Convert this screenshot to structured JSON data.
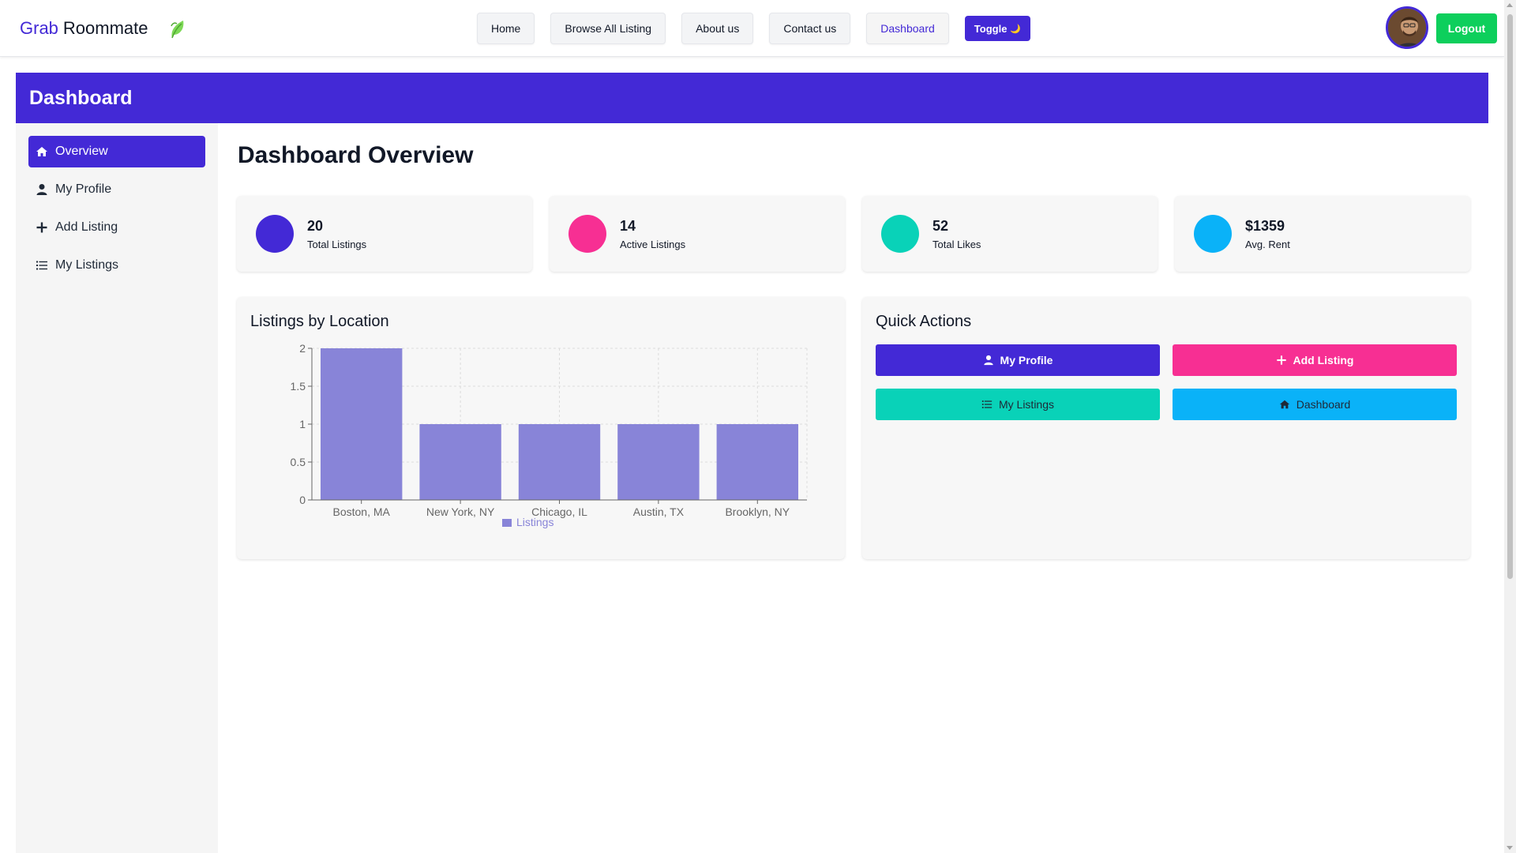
{
  "navbar": {
    "brand_part1": "Grab",
    "brand_part2": "Roommate",
    "links": [
      "Home",
      "Browse All Listing",
      "About us",
      "Contact us",
      "Dashboard"
    ],
    "active_link": "Dashboard",
    "toggle_label": "Toggle",
    "toggle_icon": "🌙",
    "logout_label": "Logout"
  },
  "header": {
    "title": "Dashboard"
  },
  "sidebar": {
    "items": [
      {
        "label": "Overview",
        "icon": "home-icon",
        "active": true
      },
      {
        "label": "My Profile",
        "icon": "user-icon",
        "active": false
      },
      {
        "label": "Add Listing",
        "icon": "plus-icon",
        "active": false
      },
      {
        "label": "My Listings",
        "icon": "list-icon",
        "active": false
      }
    ]
  },
  "main": {
    "title": "Dashboard Overview",
    "stats": [
      {
        "value": "20",
        "label": "Total Listings",
        "color": "#4329d6"
      },
      {
        "value": "14",
        "label": "Active Listings",
        "color": "#f72f93"
      },
      {
        "value": "52",
        "label": "Total Likes",
        "color": "#09d2b8"
      },
      {
        "value": "$1359",
        "label": "Avg. Rent",
        "color": "#0ab2f8"
      }
    ],
    "chart_panel_title": "Listings by Location",
    "quick_actions_title": "Quick Actions",
    "quick_actions": [
      {
        "label": "My Profile",
        "icon": "user-icon",
        "color": "#4329d6"
      },
      {
        "label": "Add Listing",
        "icon": "plus-icon",
        "color": "#f72f93"
      },
      {
        "label": "My Listings",
        "icon": "list-icon",
        "color": "#09d2b8"
      },
      {
        "label": "Dashboard",
        "icon": "home-icon",
        "color": "#0ab2f8"
      }
    ]
  },
  "colors": {
    "primary": "#4329d6",
    "success": "#0dcf5c",
    "bar": "#8884d8"
  },
  "chart_data": {
    "type": "bar",
    "categories": [
      "Boston, MA",
      "New York, NY",
      "Chicago, IL",
      "Austin, TX",
      "Brooklyn, NY"
    ],
    "series": [
      {
        "name": "Listings",
        "values": [
          2,
          1,
          1,
          1,
          1
        ]
      }
    ],
    "ylim": [
      0,
      2
    ],
    "yticks": [
      "0",
      "0.5",
      "1",
      "1.5",
      "2"
    ],
    "grid": true,
    "legend": "bottom"
  }
}
